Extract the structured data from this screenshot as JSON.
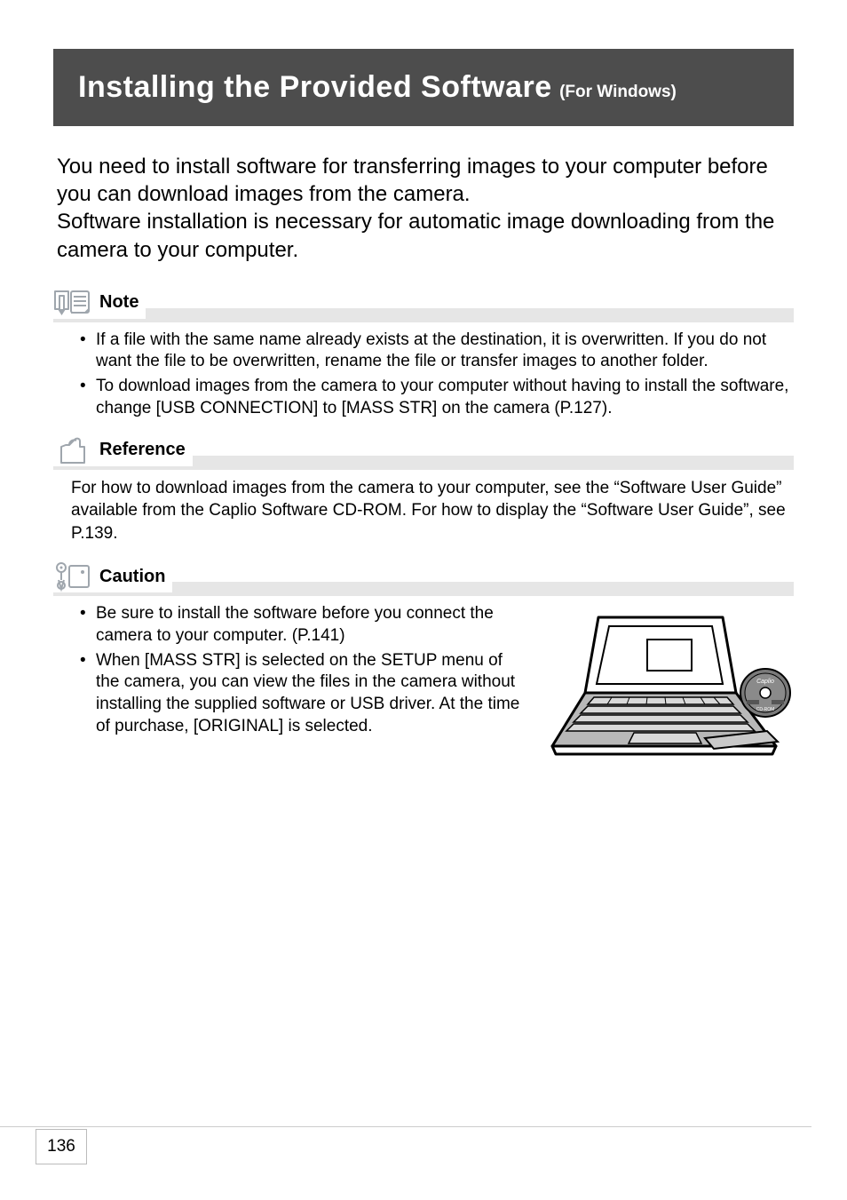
{
  "header": {
    "title_main": "Installing the Provided Software",
    "title_sub": "(For Windows)"
  },
  "intro": {
    "p1": "You need to install software for transferring images to your computer before you can download images from the camera.",
    "p2": "Software installation is necessary for automatic image downloading from the camera to your computer."
  },
  "note": {
    "label": "Note",
    "items": [
      "If a file with the same name already exists at the destination, it is overwritten. If you do not want the file to be overwritten, rename the file or transfer images to another folder.",
      "To download images from the camera to your computer without having to install the software, change [USB CONNECTION] to [MASS STR] on the camera (P.127)."
    ]
  },
  "reference": {
    "label": "Reference",
    "body": "For how to download images from the camera to your computer, see the “Software User Guide” available from the Caplio Software CD-ROM. For how to display the “Software User Guide”, see P.139."
  },
  "caution": {
    "label": "Caution",
    "items": [
      "Be sure to install the software before you connect the camera to your computer. (P.141)",
      "When [MASS STR] is selected on the SETUP menu of the camera, you can view the files in the camera without installing the supplied software or USB driver. At the time of purchase, [ORIGINAL] is selected."
    ]
  },
  "page_number": "136"
}
